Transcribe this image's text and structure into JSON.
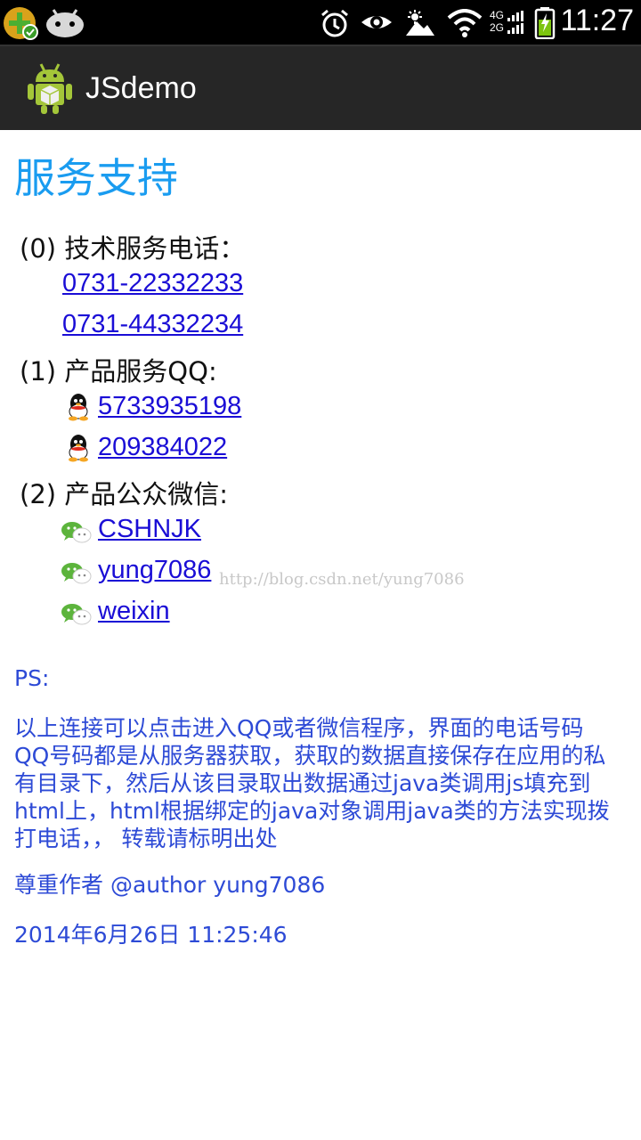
{
  "status_bar": {
    "time": "11:27",
    "icons": [
      "app-notify-icon",
      "android-notify-icon",
      "alarm-icon",
      "eye-icon",
      "brightness-icon",
      "wifi-icon",
      "signal-icon",
      "battery-icon"
    ],
    "network": [
      "4G",
      "2G"
    ]
  },
  "action_bar": {
    "title": "JSdemo",
    "icon": "android-app-icon"
  },
  "page": {
    "title": "服务支持",
    "sections": [
      {
        "label": "(0) 技术服务电话：",
        "links": [
          "0731-22332233",
          "0731-44332234"
        ]
      },
      {
        "label": "(1) 产品服务QQ:",
        "links": [
          "5733935198",
          "209384022"
        ],
        "icon": "qq-icon"
      },
      {
        "label": "(2) 产品公众微信:",
        "links": [
          "CSHNJK",
          "yung7086",
          "weixin"
        ],
        "icon": "wechat-icon"
      }
    ],
    "watermark": "http://blog.csdn.net/yung7086",
    "ps_label": "PS:",
    "ps_lines": [
      "以上连接可以点击进入QQ或者微信程序，界面的电话号码",
      "QQ号码都是从服务器获取，获取的数据直接保存在应用的私",
      "有目录下，然后从该目录取出数据通过java类调用js填充到",
      "html上，html根据绑定的java对象调用java类的方法实现拨",
      "打电话，，  转载请标明出处"
    ],
    "author": "尊重作者 @author yung7086",
    "date": "2014年6月26日 11:25:46"
  },
  "colors": {
    "title": "#1a9cf0",
    "link": "#1a0dd6",
    "ps": "#2d4ad6",
    "action_bar": "#262626"
  }
}
